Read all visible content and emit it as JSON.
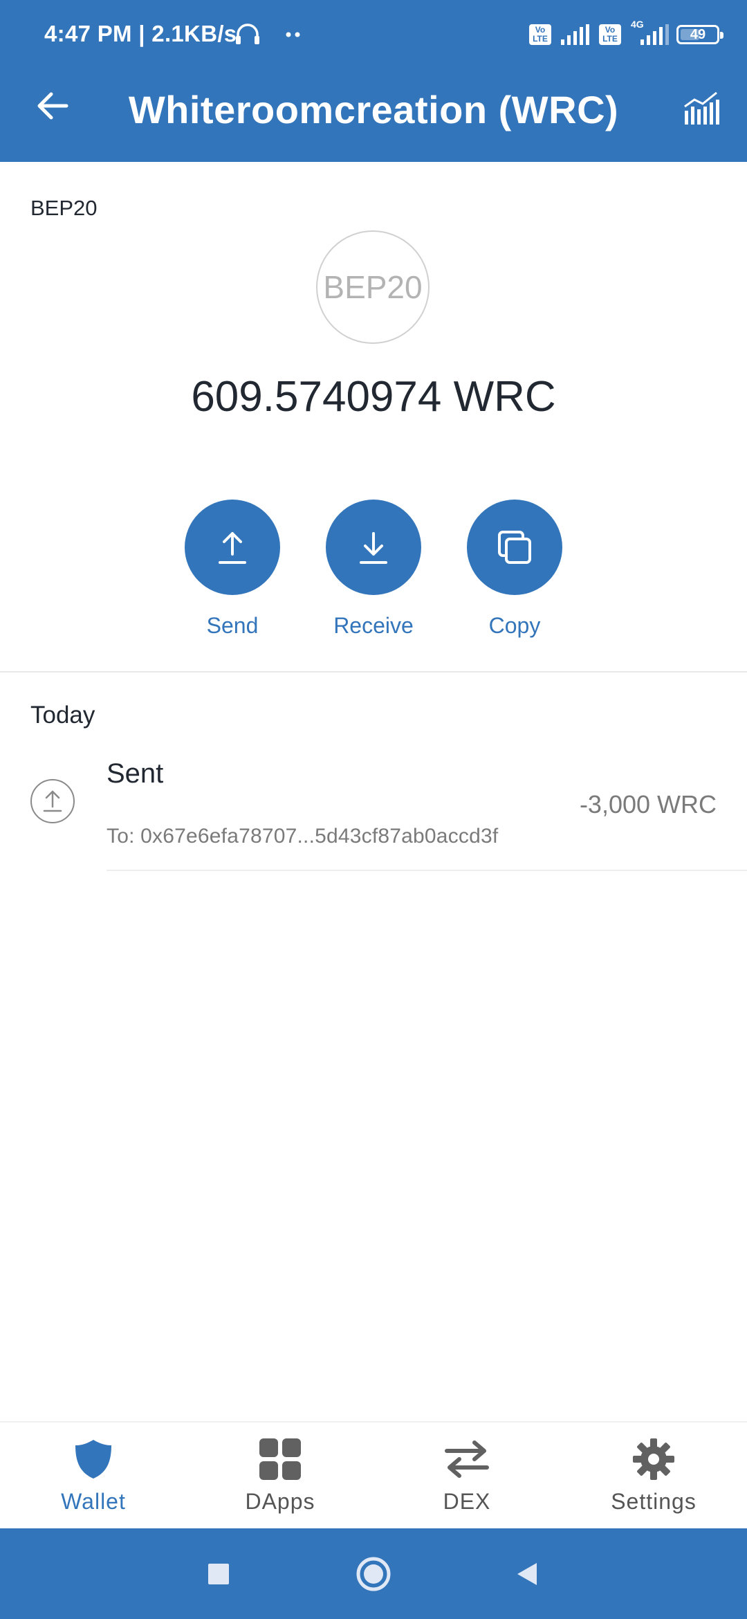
{
  "status_bar": {
    "time": "4:47 PM | 2.1KB/s",
    "volte_1": "Vo LTE",
    "volte_2": "Vo LTE",
    "network_type": "4G",
    "battery": "49"
  },
  "header": {
    "title": "Whiteroomcreation (WRC)"
  },
  "token": {
    "network": "BEP20",
    "icon_text": "BEP20",
    "balance": "609.5740974 WRC"
  },
  "actions": [
    {
      "label": "Send",
      "icon": "upload-arrow-icon"
    },
    {
      "label": "Receive",
      "icon": "download-arrow-icon"
    },
    {
      "label": "Copy",
      "icon": "copy-icon"
    }
  ],
  "transactions": {
    "section_title": "Today",
    "items": [
      {
        "type": "Sent",
        "to": "To: 0x67e6efa78707...5d43cf87ab0accd3f",
        "amount": "-3,000 WRC"
      }
    ]
  },
  "tabs": [
    {
      "label": "Wallet",
      "icon": "shield-icon",
      "active": true
    },
    {
      "label": "DApps",
      "icon": "grid-icon",
      "active": false
    },
    {
      "label": "DEX",
      "icon": "swap-arrows-icon",
      "active": false
    },
    {
      "label": "Settings",
      "icon": "gear-icon",
      "active": false
    }
  ],
  "colors": {
    "primary": "#3375bb",
    "text": "#222831",
    "muted": "#7a7a7a"
  }
}
